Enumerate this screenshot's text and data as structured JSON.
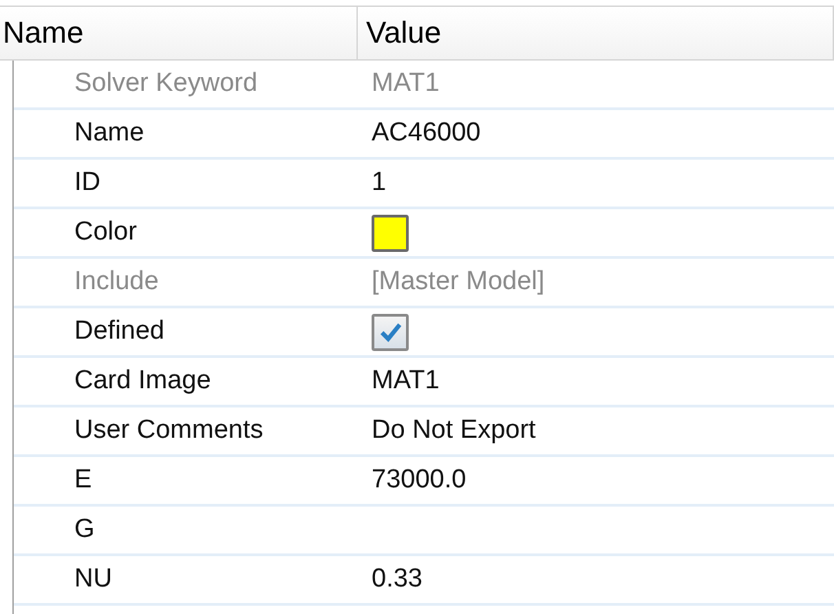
{
  "columns": [
    "Name",
    "Value"
  ],
  "rows": [
    {
      "name": "Solver Keyword",
      "kind": "text",
      "value": "MAT1",
      "disabled": true
    },
    {
      "name": "Name",
      "kind": "text",
      "value": "AC46000",
      "disabled": false
    },
    {
      "name": "ID",
      "kind": "text",
      "value": "1",
      "disabled": false
    },
    {
      "name": "Color",
      "kind": "color",
      "color": "#ffff00",
      "disabled": false
    },
    {
      "name": "Include",
      "kind": "text",
      "value": "[Master Model]",
      "disabled": true
    },
    {
      "name": "Defined",
      "kind": "checkbox",
      "checked": true,
      "disabled": false
    },
    {
      "name": "Card Image",
      "kind": "text",
      "value": "MAT1",
      "disabled": false
    },
    {
      "name": "User Comments",
      "kind": "text",
      "value": "Do Not Export",
      "disabled": false
    },
    {
      "name": "E",
      "kind": "text",
      "value": "73000.0",
      "disabled": false
    },
    {
      "name": "G",
      "kind": "text",
      "disabled": false
    },
    {
      "name": "NU",
      "kind": "text",
      "value": "0.33",
      "disabled": false
    }
  ]
}
